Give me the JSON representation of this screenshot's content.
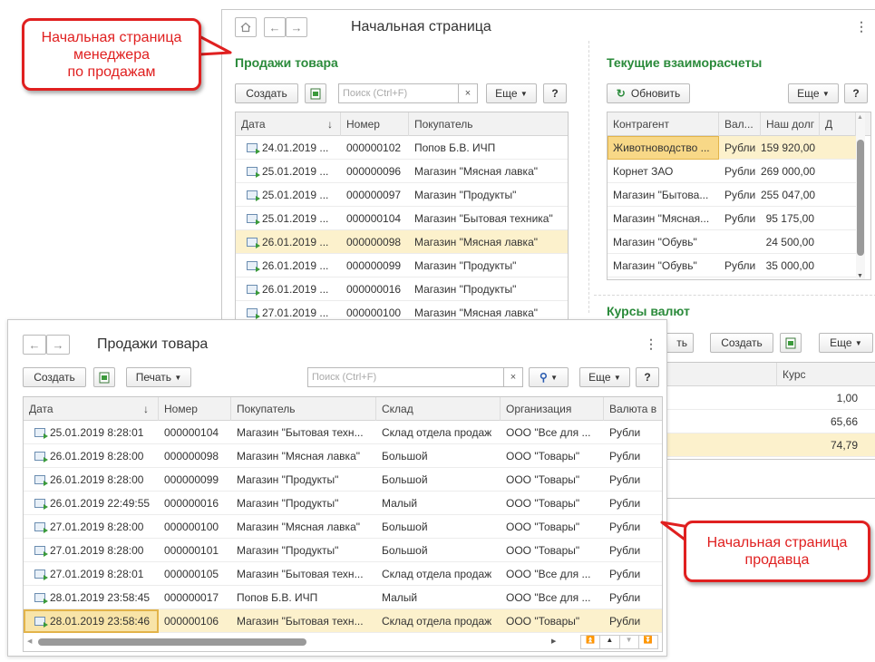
{
  "manager_window": {
    "title": "Начальная страница",
    "sales": {
      "title": "Продажи товара",
      "create_label": "Создать",
      "search_placeholder": "Поиск (Ctrl+F)",
      "more_label": "Еще",
      "help_label": "?",
      "columns": [
        "Дата",
        "Номер",
        "Покупатель"
      ],
      "rows": [
        {
          "date": "24.01.2019 ...",
          "number": "000000102",
          "buyer": "Попов Б.В. ИЧП"
        },
        {
          "date": "25.01.2019 ...",
          "number": "000000096",
          "buyer": "Магазин \"Мясная лавка\""
        },
        {
          "date": "25.01.2019 ...",
          "number": "000000097",
          "buyer": "Магазин \"Продукты\""
        },
        {
          "date": "25.01.2019 ...",
          "number": "000000104",
          "buyer": "Магазин \"Бытовая техника\""
        },
        {
          "date": "26.01.2019 ...",
          "number": "000000098",
          "buyer": "Магазин \"Мясная лавка\""
        },
        {
          "date": "26.01.2019 ...",
          "number": "000000099",
          "buyer": "Магазин \"Продукты\""
        },
        {
          "date": "26.01.2019 ...",
          "number": "000000016",
          "buyer": "Магазин \"Продукты\""
        },
        {
          "date": "27.01.2019 ...",
          "number": "000000100",
          "buyer": "Магазин \"Мясная лавка\""
        }
      ]
    },
    "settlements": {
      "title": "Текущие взаиморасчеты",
      "refresh_label": "Обновить",
      "more_label": "Еще",
      "help_label": "?",
      "columns": [
        "Контрагент",
        "Вал...",
        "Наш долг",
        "Д"
      ],
      "rows": [
        {
          "name": "Животноводство ...",
          "cur": "Рубли",
          "debt": "159 920,00"
        },
        {
          "name": "Корнет ЗАО",
          "cur": "Рубли",
          "debt": "269 000,00"
        },
        {
          "name": "Магазин \"Бытова...",
          "cur": "Рубли",
          "debt": "255 047,00"
        },
        {
          "name": "Магазин \"Мясная...",
          "cur": "Рубли",
          "debt": "95 175,00"
        },
        {
          "name": "Магазин \"Обувь\"",
          "cur": "",
          "debt": "24 500,00"
        },
        {
          "name": "Магазин \"Обувь\"",
          "cur": "Рубли",
          "debt": "35 000,00"
        }
      ]
    },
    "rates": {
      "title": "Курсы валют",
      "partial_btn": "ть",
      "create_label": "Создать",
      "more_label": "Еще",
      "column": "Курс",
      "values": [
        "1,00",
        "65,66",
        "74,79"
      ]
    }
  },
  "seller_window": {
    "title": "Продажи товара",
    "create_label": "Создать",
    "print_label": "Печать",
    "search_placeholder": "Поиск (Ctrl+F)",
    "more_label": "Еще",
    "help_label": "?",
    "columns": [
      "Дата",
      "Номер",
      "Покупатель",
      "Склад",
      "Организация",
      "Валюта в"
    ],
    "rows": [
      {
        "date": "25.01.2019 8:28:01",
        "number": "000000104",
        "buyer": "Магазин \"Бытовая техн...",
        "store": "Склад отдела продаж",
        "org": "ООО \"Все для ...",
        "cur": "Рубли"
      },
      {
        "date": "26.01.2019 8:28:00",
        "number": "000000098",
        "buyer": "Магазин \"Мясная лавка\"",
        "store": "Большой",
        "org": "ООО \"Товары\"",
        "cur": "Рубли"
      },
      {
        "date": "26.01.2019 8:28:00",
        "number": "000000099",
        "buyer": "Магазин \"Продукты\"",
        "store": "Большой",
        "org": "ООО \"Товары\"",
        "cur": "Рубли"
      },
      {
        "date": "26.01.2019 22:49:55",
        "number": "000000016",
        "buyer": "Магазин \"Продукты\"",
        "store": "Малый",
        "org": "ООО \"Товары\"",
        "cur": "Рубли"
      },
      {
        "date": "27.01.2019 8:28:00",
        "number": "000000100",
        "buyer": "Магазин \"Мясная лавка\"",
        "store": "Большой",
        "org": "ООО \"Товары\"",
        "cur": "Рубли"
      },
      {
        "date": "27.01.2019 8:28:00",
        "number": "000000101",
        "buyer": "Магазин \"Продукты\"",
        "store": "Большой",
        "org": "ООО \"Товары\"",
        "cur": "Рубли"
      },
      {
        "date": "27.01.2019 8:28:01",
        "number": "000000105",
        "buyer": "Магазин \"Бытовая техн...",
        "store": "Склад отдела продаж",
        "org": "ООО \"Все для ...",
        "cur": "Рубли"
      },
      {
        "date": "28.01.2019 23:58:45",
        "number": "000000017",
        "buyer": "Попов Б.В. ИЧП",
        "store": "Малый",
        "org": "ООО \"Все для ...",
        "cur": "Рубли"
      },
      {
        "date": "28.01.2019 23:58:46",
        "number": "000000106",
        "buyer": "Магазин \"Бытовая техн...",
        "store": "Склад отдела продаж",
        "org": "ООО \"Товары\"",
        "cur": "Рубли"
      }
    ]
  },
  "callouts": {
    "manager_line1": "Начальная страница",
    "manager_line2": "менеджера",
    "manager_line3": "по продажам",
    "seller_line1": "Начальная страница",
    "seller_line2": "продавца"
  },
  "colors": {
    "accent_green": "#2a8a3a",
    "selection": "#fcf1cc",
    "callout_red": "#e02020"
  }
}
